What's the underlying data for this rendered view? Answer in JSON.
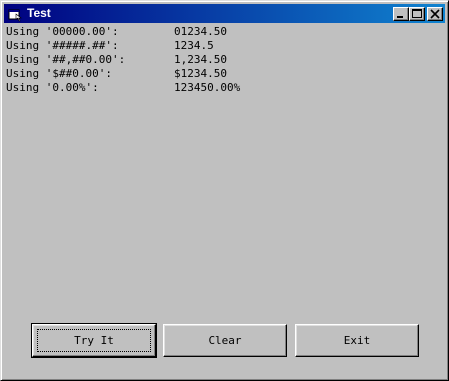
{
  "window": {
    "title": "Test",
    "icon": "app-window-icon",
    "controls": {
      "minimize_icon": "minimize-icon",
      "maximize_icon": "maximize-icon",
      "close_icon": "close-icon"
    },
    "colors": {
      "face": "#c0c0c0",
      "titlebar_start": "#000080",
      "titlebar_end": "#1084d0"
    }
  },
  "output": {
    "rows": [
      {
        "label": "Using '00000.00':",
        "value": "01234.50"
      },
      {
        "label": "Using '#####.##':",
        "value": "1234.5"
      },
      {
        "label": "Using '##,##0.00':",
        "value": "1,234.50"
      },
      {
        "label": "Using '$##0.00':",
        "value": "$1234.50"
      },
      {
        "label": "Using '0.00%':",
        "value": "123450.00%"
      }
    ]
  },
  "buttons": {
    "try_it": "Try It",
    "clear": "Clear",
    "exit": "Exit"
  }
}
